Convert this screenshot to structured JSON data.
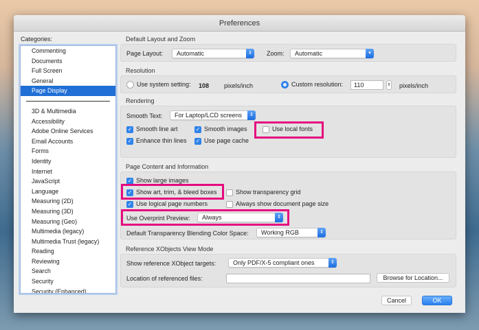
{
  "window": {
    "title": "Preferences"
  },
  "categories": {
    "label": "Categories:",
    "group1": [
      "Commenting",
      "Documents",
      "Full Screen",
      "General",
      "Page Display"
    ],
    "selected": "Page Display",
    "group2": [
      "3D & Multimedia",
      "Accessibility",
      "Adobe Online Services",
      "Email Accounts",
      "Forms",
      "Identity",
      "Internet",
      "JavaScript",
      "Language",
      "Measuring (2D)",
      "Measuring (3D)",
      "Measuring (Geo)",
      "Multimedia (legacy)",
      "Multimedia Trust (legacy)",
      "Reading",
      "Reviewing",
      "Search",
      "Security",
      "Security (Enhanced)"
    ]
  },
  "layout": {
    "title": "Default Layout and Zoom",
    "page_layout_label": "Page Layout:",
    "page_layout_value": "Automatic",
    "zoom_label": "Zoom:",
    "zoom_value": "Automatic"
  },
  "resolution": {
    "title": "Resolution",
    "system_label": "Use system setting:",
    "system_value": "108",
    "unit1": "pixels/inch",
    "custom_label": "Custom resolution:",
    "custom_value": "110",
    "unit2": "pixels/inch",
    "selected": "custom"
  },
  "rendering": {
    "title": "Rendering",
    "smooth_text_label": "Smooth Text:",
    "smooth_text_value": "For Laptop/LCD screens",
    "options": [
      {
        "label": "Smooth line art",
        "checked": true
      },
      {
        "label": "Smooth images",
        "checked": true
      },
      {
        "label": "Use local fonts",
        "checked": false
      },
      {
        "label": "Enhance thin lines",
        "checked": true
      },
      {
        "label": "Use page cache",
        "checked": true
      }
    ]
  },
  "content": {
    "title": "Page Content and Information",
    "options": [
      {
        "label": "Show large images",
        "checked": true
      },
      {
        "label": "Show art, trim, & bleed boxes",
        "checked": true
      },
      {
        "label": "Show transparency grid",
        "checked": false
      },
      {
        "label": "Use logical page numbers",
        "checked": true
      },
      {
        "label": "Always show document page size",
        "checked": false
      }
    ],
    "overprint_label": "Use Overprint Preview:",
    "overprint_value": "Always",
    "blend_label": "Default Transparency Blending Color Space:",
    "blend_value": "Working RGB"
  },
  "xobjects": {
    "title": "Reference XObjects View Mode",
    "targets_label": "Show reference XObject targets:",
    "targets_value": "Only PDF/X-5 compliant ones",
    "location_label": "Location of referenced files:",
    "location_value": "",
    "browse_label": "Browse for Location..."
  },
  "footer": {
    "cancel": "Cancel",
    "ok": "OK"
  },
  "colors": {
    "accent": "#1f6fd6",
    "highlight": "#e5097f"
  }
}
